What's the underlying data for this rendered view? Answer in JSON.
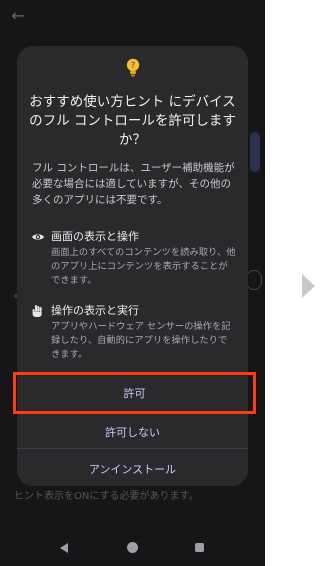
{
  "screen": {
    "back_icon": "arrow-left-icon",
    "footnote": "ヒント表示をONにする必要があります。"
  },
  "dialog": {
    "app_icon": "lightbulb-question-icon",
    "title_lines": [
      "おすすめ使い方ヒント にデバイス",
      "のフル コントロールを許可します",
      "か？"
    ],
    "description_lines": [
      "フル コントロールは、ユーザー補助機能が",
      "必要な場合には適していますが、その他の",
      "多くのアプリには不要です。"
    ],
    "permissions": [
      {
        "icon": "eye-icon",
        "title": "画面の表示と操作",
        "body_lines": [
          "画面上のすべてのコンテンツを読み取り、他",
          "のアプリ上にコンテンツを表示することが",
          "できます。"
        ]
      },
      {
        "icon": "hand-icon",
        "title": "操作の表示と実行",
        "body_lines": [
          "アプリやハードウェア センサーの操作を記",
          "録したり、自動的にアプリを操作したりで",
          "きます。"
        ]
      }
    ],
    "allow_label": "許可",
    "deny_label": "許可しない",
    "uninstall_label": "アンインストール"
  },
  "navbar": {
    "back_icon": "nav-back-icon",
    "home_icon": "nav-home-icon",
    "recents_icon": "nav-recents-icon"
  },
  "next_arrow_icon": "chevron-right-icon",
  "colors": {
    "highlight": "#ff3b12",
    "button_text": "#c8cbff",
    "dialog_bg": "#2a2a2d",
    "screen_bg": "#161618"
  }
}
